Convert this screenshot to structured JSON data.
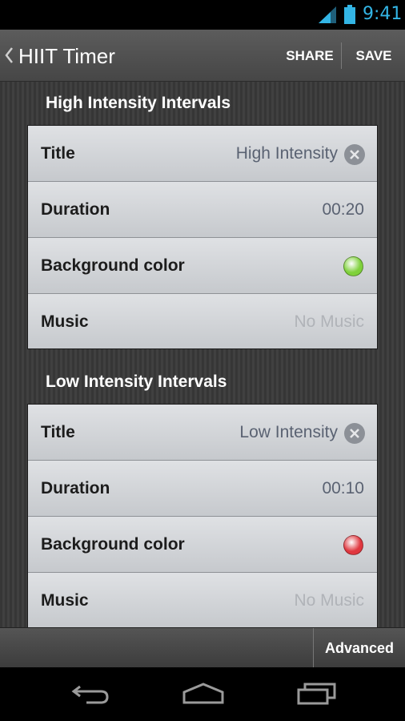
{
  "status_bar": {
    "time": "9:41",
    "accent_color": "#33b5e5",
    "icons": [
      "signal-icon",
      "battery-icon"
    ]
  },
  "action_bar": {
    "title": "HIIT Timer",
    "share_label": "SHARE",
    "save_label": "SAVE",
    "up_icon": "chevron-left-icon"
  },
  "high_intensity": {
    "header": "High Intensity Intervals",
    "title_label": "Title",
    "title_value": "High Intensity",
    "duration_label": "Duration",
    "duration_value": "00:20",
    "color_label": "Background color",
    "color_value": "#7fd13b",
    "music_label": "Music",
    "music_value": "No Music"
  },
  "low_intensity": {
    "header": "Low Intensity Intervals",
    "title_label": "Title",
    "title_value": "Low Intensity",
    "duration_label": "Duration",
    "duration_value": "00:10",
    "color_label": "Background color",
    "color_value": "#e0373f",
    "music_label": "Music",
    "music_value": "No Music"
  },
  "bottom_bar": {
    "advanced_label": "Advanced"
  },
  "nav_bar": {
    "icons": [
      "back-icon",
      "home-icon",
      "recent-apps-icon"
    ]
  }
}
